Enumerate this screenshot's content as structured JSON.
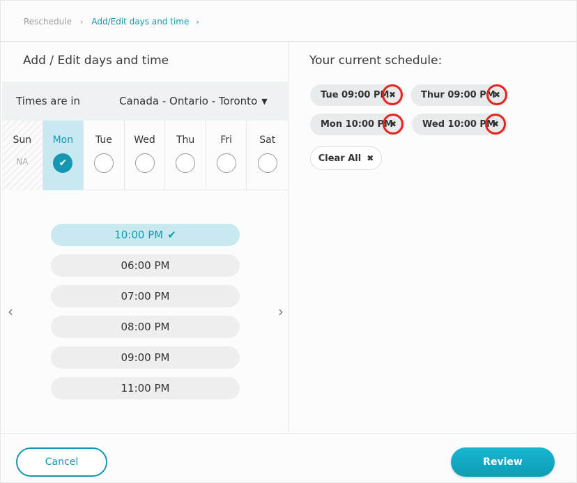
{
  "breadcrumb": {
    "items": [
      "Reschedule",
      "Add/Edit days and time"
    ],
    "separator": "›"
  },
  "left": {
    "title": "Add / Edit days and time",
    "timezone_label": "Times are in",
    "timezone_value": "Canada - Ontario - Toronto",
    "days": [
      {
        "name": "Sun",
        "status": "NA"
      },
      {
        "name": "Mon",
        "status": "selected"
      },
      {
        "name": "Tue",
        "status": "unselected"
      },
      {
        "name": "Wed",
        "status": "unselected"
      },
      {
        "name": "Thu",
        "status": "unselected"
      },
      {
        "name": "Fri",
        "status": "unselected"
      },
      {
        "name": "Sat",
        "status": "unselected"
      }
    ],
    "times": [
      "10:00 PM",
      "06:00 PM",
      "07:00 PM",
      "08:00 PM",
      "09:00 PM",
      "11:00 PM"
    ],
    "selected_time": "10:00 PM"
  },
  "right": {
    "title": "Your current schedule:",
    "tags": [
      "Tue 09:00 PM",
      "Thur 09:00 PM",
      "Mon 10:00 PM",
      "Wed 10:00 PM"
    ],
    "clear_all": "Clear All"
  },
  "footer": {
    "cancel": "Cancel",
    "review": "Review"
  },
  "colors": {
    "accent": "#1597b1",
    "selected_bg": "#c9e9f0",
    "highlight_ring": "#e8231f"
  }
}
